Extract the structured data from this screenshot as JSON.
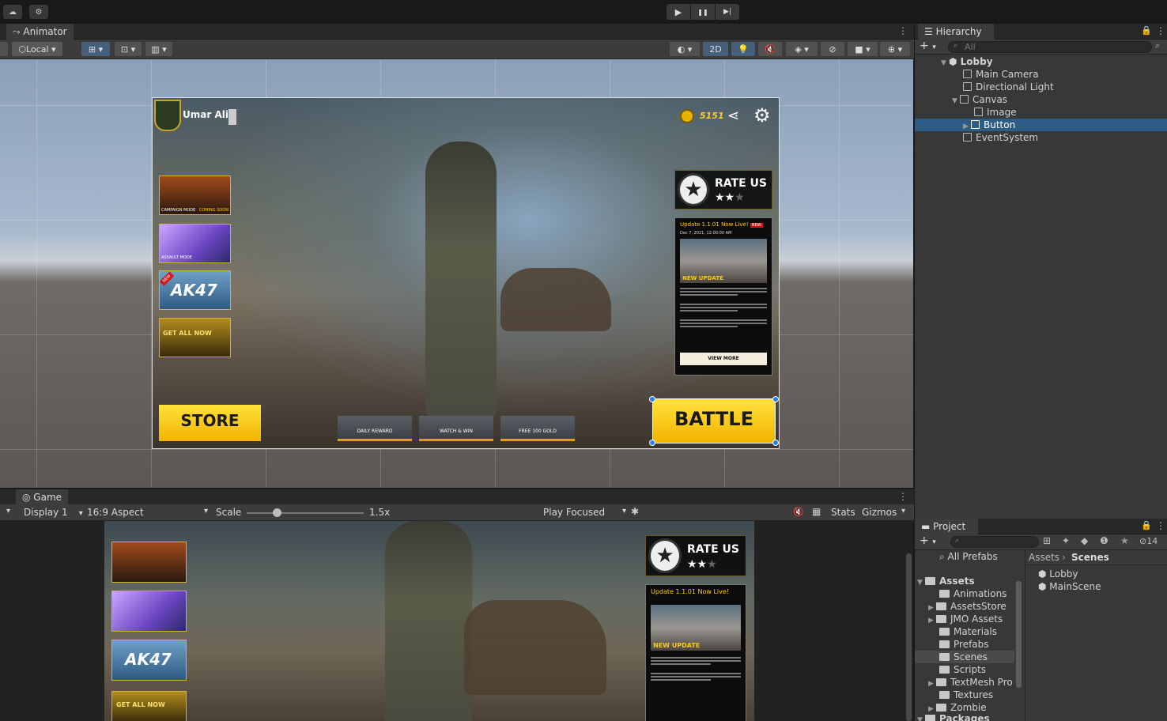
{
  "topbar": {
    "cloud_icon": "cloud-icon",
    "settings_icon": "gear-icon",
    "play": "▶",
    "pause": "❚❚",
    "step": "▶|"
  },
  "animator": {
    "tab_label": "Animator",
    "toolbar": {
      "pivot_mode": "Local",
      "mode_2d": "2D"
    }
  },
  "scene_canvas": {
    "player_name": "Umar Ali",
    "coins": "5151",
    "rate_us": "RATE US",
    "update_title": "Update 1.1.01 Now Live!",
    "update_badge": "NEW",
    "update_date": "Dec 7, 2021, 12:00:00 AM",
    "new_update": "NEW UPDATE",
    "view_more": "VIEW MORE",
    "campaign": "CAMPAIGN MODE",
    "coming_soon": "COMING SOON",
    "assault": "ASSAULT MODE",
    "ak47": "AK47",
    "get_all": "GET ALL NOW",
    "store": "STORE",
    "daily_reward": "DAILY REWARD",
    "watch_win": "WATCH & WIN",
    "free_gold": "FREE 100 GOLD",
    "battle": "BATTLE"
  },
  "game": {
    "tab_label": "Game",
    "display": "Display 1",
    "aspect": "16:9 Aspect",
    "scale_label": "Scale",
    "scale_value": "1.5x",
    "play_focused": "Play Focused",
    "stats": "Stats",
    "gizmos": "Gizmos",
    "rate_us": "RATE US",
    "update_title": "Update 1.1.01 Now Live!",
    "new_update": "NEW UPDATE",
    "ak47": "AK47",
    "get_all": "GET ALL NOW"
  },
  "hierarchy": {
    "tab_label": "Hierarchy",
    "search_placeholder": "All",
    "scene": "Lobby",
    "items": [
      "Main Camera",
      "Directional Light",
      "Canvas",
      "Image",
      "Button",
      "EventSystem"
    ]
  },
  "project": {
    "tab_label": "Project",
    "hidden_count": "14",
    "all_prefabs": "All Prefabs",
    "assets_root": "Assets",
    "folders": [
      "Animations",
      "AssetsStore",
      "JMO Assets",
      "Materials",
      "Prefabs",
      "Scenes",
      "Scripts",
      "TextMesh Pro",
      "Textures",
      "Zombie"
    ],
    "packages": "Packages",
    "breadcrumb": [
      "Assets",
      "Scenes"
    ],
    "files": [
      "Lobby",
      "MainScene"
    ]
  }
}
